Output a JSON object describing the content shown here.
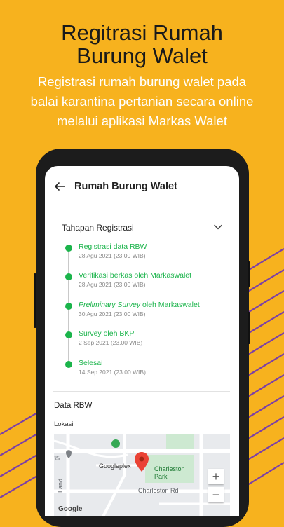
{
  "promo": {
    "title_line1": "Regitrasi Rumah",
    "title_line2": "Burung Walet",
    "subtitle_line1": "Registrasi rumah burung walet pada",
    "subtitle_line2": "balai karantina pertanian secara online",
    "subtitle_line3": "melalui aplikasi Markas Walet"
  },
  "colors": {
    "background": "#F7B21E",
    "stripes": "#7B3FA8",
    "accent_green": "#1BB44B",
    "map_pin": "#EA4335"
  },
  "appbar": {
    "back_icon": "arrow-left-icon",
    "title": "Rumah Burung Walet"
  },
  "registration": {
    "title": "Tahapan Registrasi",
    "toggle_icon": "chevron-down-icon",
    "steps": [
      {
        "label": "Registrasi data RBW",
        "date": "28 Agu 2021 (23.00 WIB)",
        "status": "done"
      },
      {
        "label": "Verifikasi berkas oleh Markaswalet",
        "date": "28 Agu 2021 (23.00 WIB)",
        "status": "done"
      },
      {
        "label_italic": "Preliminary Survey",
        "label_rest": " oleh Markaswalet",
        "date": "30 Agu 2021 (23.00 WIB)",
        "status": "done"
      },
      {
        "label": "Survey oleh BKP",
        "date": "2 Sep 2021 (23.00 WIB)",
        "status": "done"
      },
      {
        "label": "Selesai",
        "date": "14 Sep 2021 (23.00 WIB)",
        "status": "done"
      }
    ]
  },
  "data_rbw": {
    "title": "Data RBW",
    "location_label": "Lokasi",
    "map": {
      "place": "Googleplex",
      "park": "Charleston Park",
      "park_line1": "Charleston",
      "park_line2": "Park",
      "road": "Charleston Rd",
      "edge_label_left": "85",
      "edge_label_vertical": "Land",
      "logo": "Google",
      "zoom_in": "+",
      "zoom_out": "−"
    }
  }
}
